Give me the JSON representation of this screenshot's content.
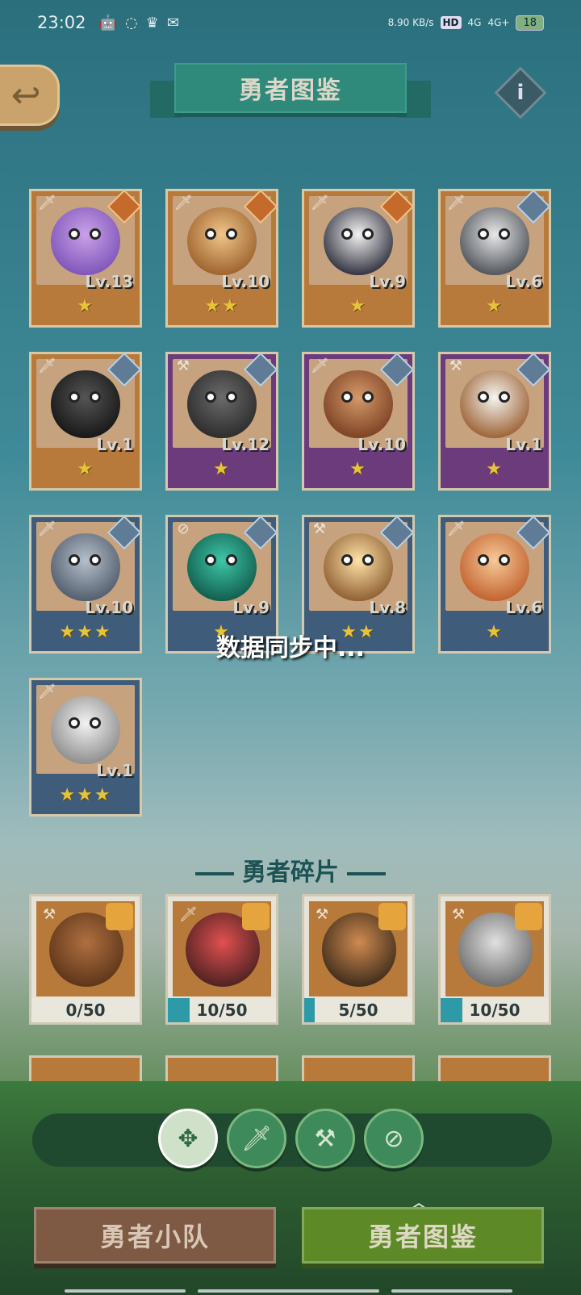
{
  "status_bar": {
    "time": "23:02",
    "net_speed": "8.90 KB/s",
    "hd": "HD",
    "signal1": "4G",
    "signal2": "4G+",
    "battery": "18"
  },
  "header": {
    "title": "勇者图鉴"
  },
  "heroes": [
    {
      "level": "Lv.13",
      "stars": "★",
      "frame": "orange",
      "role": "sword-icon",
      "element": "fire-icon",
      "c1": "#c9a2e8",
      "c2": "#7d52b8"
    },
    {
      "level": "Lv.10",
      "stars": "★★",
      "frame": "orange",
      "role": "sword-icon",
      "element": "fire-icon",
      "c1": "#f0c58a",
      "c2": "#9a5f2a"
    },
    {
      "level": "Lv.9",
      "stars": "★",
      "frame": "orange",
      "role": "sword-icon",
      "element": "fire-icon",
      "c1": "#f2f2f2",
      "c2": "#2b2b3a"
    },
    {
      "level": "Lv.6",
      "stars": "★",
      "frame": "orange",
      "role": "sword-icon",
      "element": "hammer-icon",
      "c1": "#e8e8e8",
      "c2": "#4a4f56"
    },
    {
      "level": "Lv.1",
      "stars": "★",
      "frame": "orange",
      "role": "sword-icon",
      "element": "hammer-icon",
      "c1": "#555555",
      "c2": "#151515"
    },
    {
      "level": "Lv.12",
      "stars": "★",
      "frame": "purple",
      "role": "hammer-icon",
      "element": "hammer-icon",
      "c1": "#6b6b6b",
      "c2": "#2a2a2a"
    },
    {
      "level": "Lv.10",
      "stars": "★",
      "frame": "purple",
      "role": "sword-icon",
      "element": "hammer-icon",
      "c1": "#d49a6a",
      "c2": "#7a3e22"
    },
    {
      "level": "Lv.1",
      "stars": "★",
      "frame": "purple",
      "role": "hammer-icon",
      "element": "hammer-icon",
      "c1": "#f5f5f0",
      "c2": "#9a5c2e"
    },
    {
      "level": "Lv.10",
      "stars": "★★★",
      "frame": "blue",
      "role": "sword-icon",
      "element": "hammer-icon",
      "c1": "#b6c0cc",
      "c2": "#4f5a6a"
    },
    {
      "level": "Lv.9",
      "stars": "★",
      "frame": "blue",
      "role": "compass-icon",
      "element": "hammer-icon",
      "c1": "#3fc6a8",
      "c2": "#0f5a4a"
    },
    {
      "level": "Lv.8",
      "stars": "★★",
      "frame": "blue",
      "role": "hammer-icon",
      "element": "hammer-icon",
      "c1": "#ffe2a8",
      "c2": "#8a5a2e"
    },
    {
      "level": "Lv.6",
      "stars": "★",
      "frame": "blue",
      "role": "sword-icon",
      "element": "hammer-icon",
      "c1": "#f8c99a",
      "c2": "#c05f2a"
    },
    {
      "level": "Lv.1",
      "stars": "★★★",
      "frame": "blue",
      "role": "sword-icon",
      "element": "none",
      "c1": "#f2f2f2",
      "c2": "#8a8a8a"
    }
  ],
  "sync_text": "数据同步中...",
  "fragments": {
    "heading": "勇者碎片",
    "items": [
      {
        "progress_text": "0/50",
        "progress": 0.0,
        "role": "hammer-icon",
        "c1": "#b07040",
        "c2": "#5a3318"
      },
      {
        "progress_text": "10/50",
        "progress": 0.2,
        "role": "sword-icon",
        "c1": "#e05050",
        "c2": "#4a2020"
      },
      {
        "progress_text": "5/50",
        "progress": 0.1,
        "role": "hammer-icon",
        "c1": "#d08a50",
        "c2": "#3a2a1a"
      },
      {
        "progress_text": "10/50",
        "progress": 0.2,
        "role": "hammer-icon",
        "c1": "#e0e0e0",
        "c2": "#6a6a6a"
      }
    ]
  },
  "filters": [
    {
      "icon": "all-icon",
      "active": true
    },
    {
      "icon": "sword-icon",
      "active": false
    },
    {
      "icon": "hammer-icon",
      "active": false
    },
    {
      "icon": "compass-icon",
      "active": false
    }
  ],
  "tabs": {
    "team": "勇者小队",
    "gallery": "勇者图鉴"
  }
}
